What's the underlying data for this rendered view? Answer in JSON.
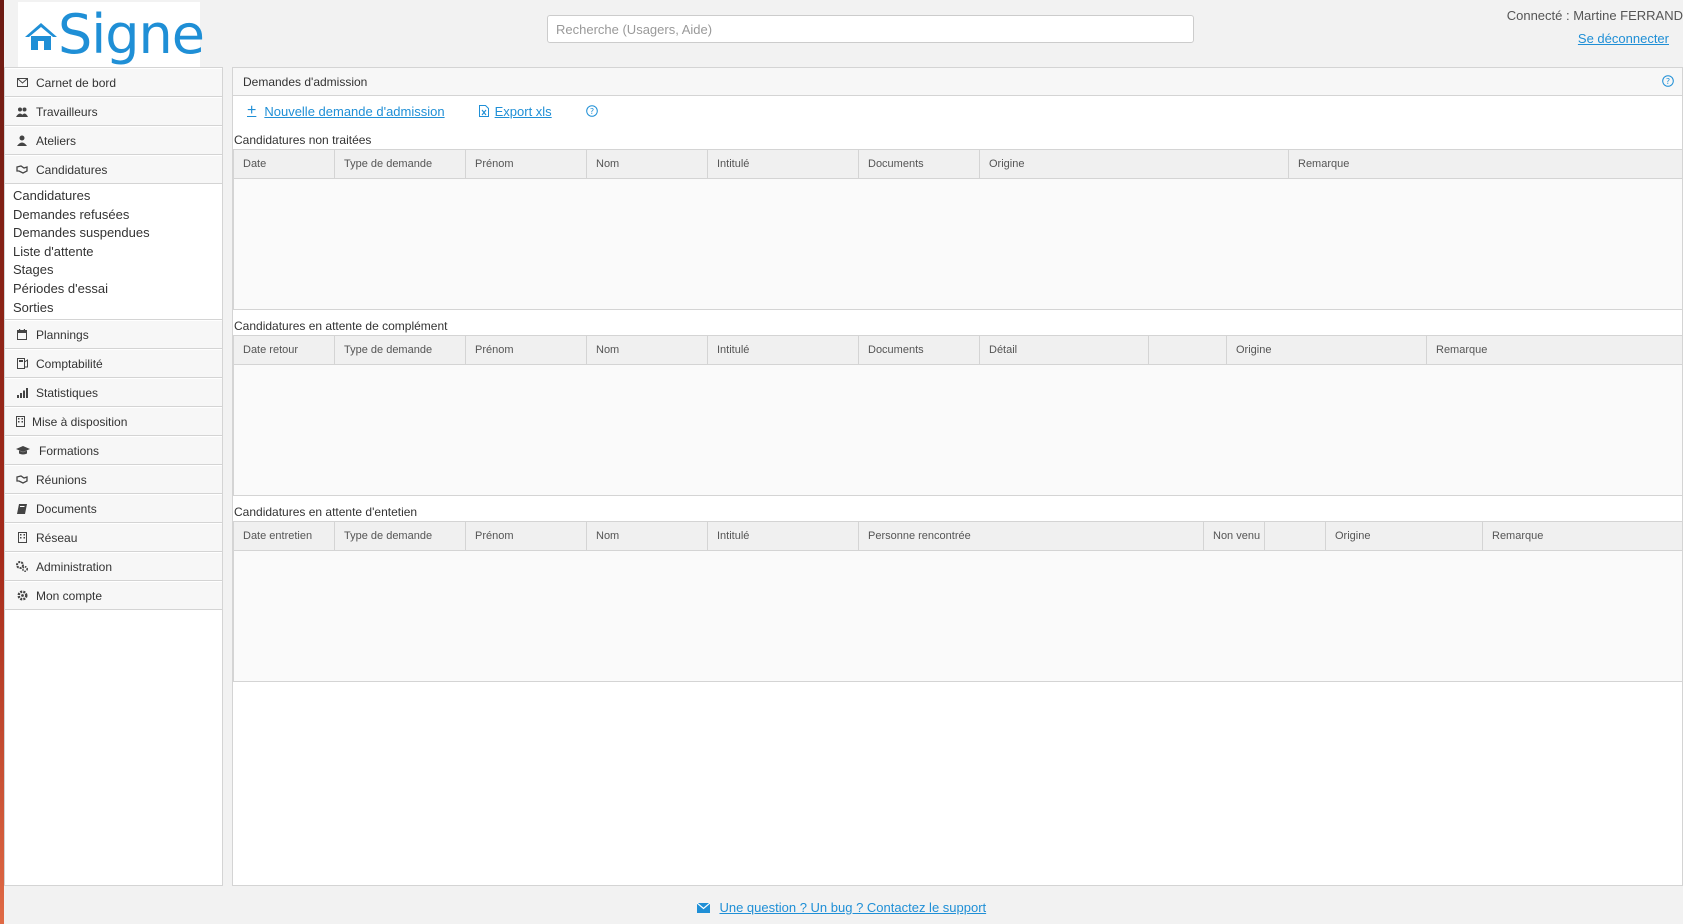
{
  "header": {
    "logo_text": "Signe",
    "search_placeholder": "Recherche (Usagers, Aide)",
    "user_label": "Connecté : Martine FERRAND",
    "logout_label": "Se déconnecter"
  },
  "sidebar": {
    "items_top": [
      {
        "label": "Carnet de bord",
        "icon": "envelope-icon"
      },
      {
        "label": "Travailleurs",
        "icon": "users-icon"
      },
      {
        "label": "Ateliers",
        "icon": "worker-icon"
      },
      {
        "label": "Candidatures",
        "icon": "handshake-icon"
      }
    ],
    "subitems": [
      "Candidatures",
      "Demandes refusées",
      "Demandes suspendues",
      "Liste d'attente",
      "Stages",
      "Périodes d'essai",
      "Sorties"
    ],
    "items_bottom": [
      {
        "label": "Plannings",
        "icon": "calendar-icon"
      },
      {
        "label": "Comptabilité",
        "icon": "calculator-icon"
      },
      {
        "label": "Statistiques",
        "icon": "bar-chart-icon"
      },
      {
        "label": "Mise à disposition",
        "icon": "building-icon"
      },
      {
        "label": "Formations",
        "icon": "graduation-cap-icon"
      },
      {
        "label": "Réunions",
        "icon": "handshake-icon"
      },
      {
        "label": "Documents",
        "icon": "book-icon"
      },
      {
        "label": "Réseau",
        "icon": "building-icon"
      },
      {
        "label": "Administration",
        "icon": "gears-icon"
      },
      {
        "label": "Mon compte",
        "icon": "gear-icon"
      }
    ]
  },
  "main": {
    "title": "Demandes d'admission",
    "new_request_label": "Nouvelle demande d'admission",
    "export_label": "Export xls",
    "sections": [
      {
        "title": "Candidatures non traitées",
        "columns": [
          "Date",
          "Type de demande",
          "Prénom",
          "Nom",
          "Intitulé",
          "Documents",
          "Origine",
          "Remarque"
        ]
      },
      {
        "title": "Candidatures en attente de complément",
        "columns": [
          "Date retour",
          "Type de demande",
          "Prénom",
          "Nom",
          "Intitulé",
          "Documents",
          "Détail",
          "",
          "Origine",
          "Remarque"
        ]
      },
      {
        "title": "Candidatures en attente d'entetien",
        "columns": [
          "Date entretien",
          "Type de demande",
          "Prénom",
          "Nom",
          "Intitulé",
          "Personne rencontrée",
          "Non venu",
          "",
          "Origine",
          "Remarque"
        ]
      }
    ]
  },
  "footer": {
    "support_label": "Une question ? Un bug ? Contactez le support"
  },
  "colors": {
    "accent": "#1f8fd6",
    "border": "#d4d4d4"
  }
}
